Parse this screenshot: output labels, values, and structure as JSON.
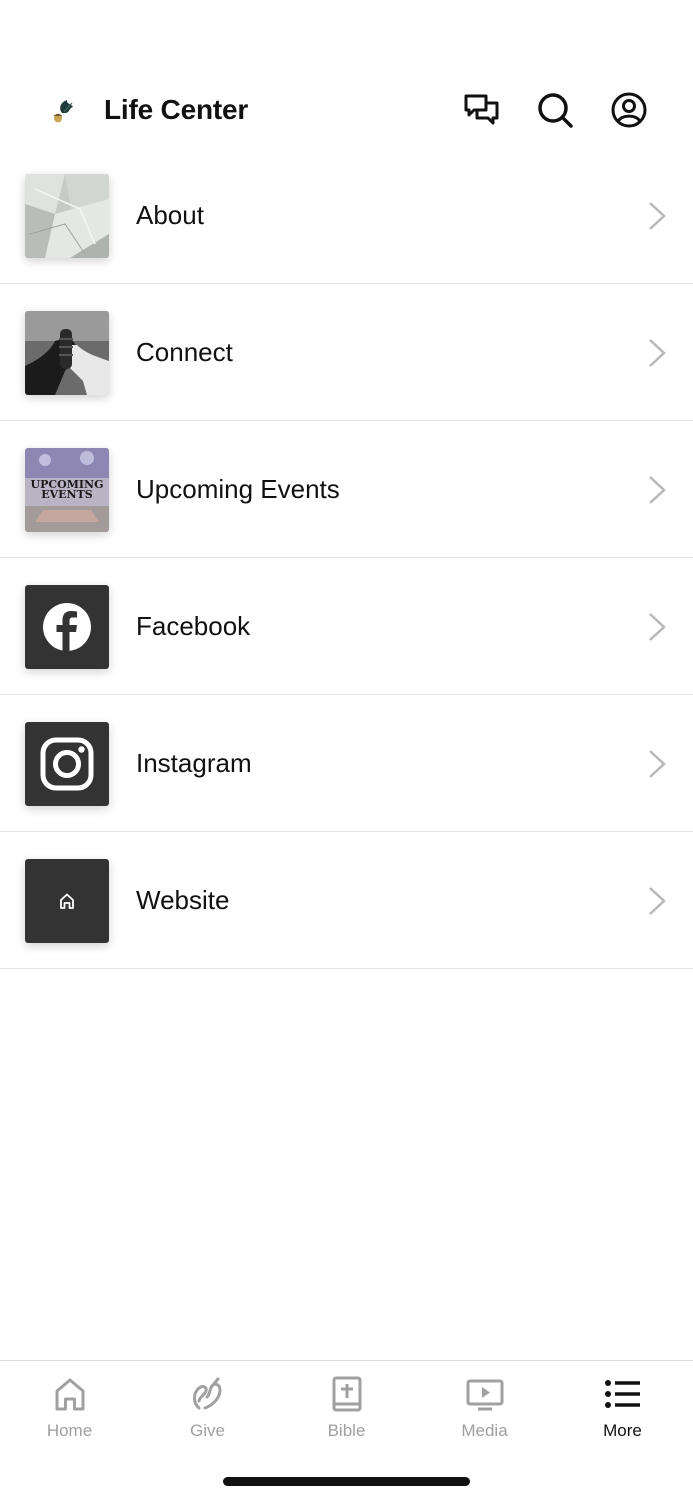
{
  "header": {
    "title": "Life Center",
    "logo_icon": "oak-leaf-acorn-logo",
    "actions": [
      "chat-icon",
      "search-icon",
      "profile-icon"
    ]
  },
  "menu": {
    "items": [
      {
        "label": "About",
        "thumbnail": "abstract-paper-shapes-image"
      },
      {
        "label": "Connect",
        "thumbnail": "clasped-hands-image"
      },
      {
        "label": "Upcoming Events",
        "thumbnail": "upcoming-events-image",
        "thumb_text": "UPCOMING EVENTS"
      },
      {
        "label": "Facebook",
        "thumbnail": "facebook-icon"
      },
      {
        "label": "Instagram",
        "thumbnail": "instagram-icon"
      },
      {
        "label": "Website",
        "thumbnail": "home-icon"
      }
    ]
  },
  "tabbar": {
    "tabs": [
      {
        "label": "Home",
        "icon": "home-icon",
        "active": false
      },
      {
        "label": "Give",
        "icon": "give-icon",
        "active": false
      },
      {
        "label": "Bible",
        "icon": "bible-icon",
        "active": false
      },
      {
        "label": "Media",
        "icon": "media-icon",
        "active": false
      },
      {
        "label": "More",
        "icon": "list-icon",
        "active": true
      }
    ]
  },
  "colors": {
    "text": "#111111",
    "inactive_tab": "#a0a0a0",
    "divider": "#e3e3e3",
    "tile_dark": "#333333",
    "chevron": "#b8b8b8"
  }
}
